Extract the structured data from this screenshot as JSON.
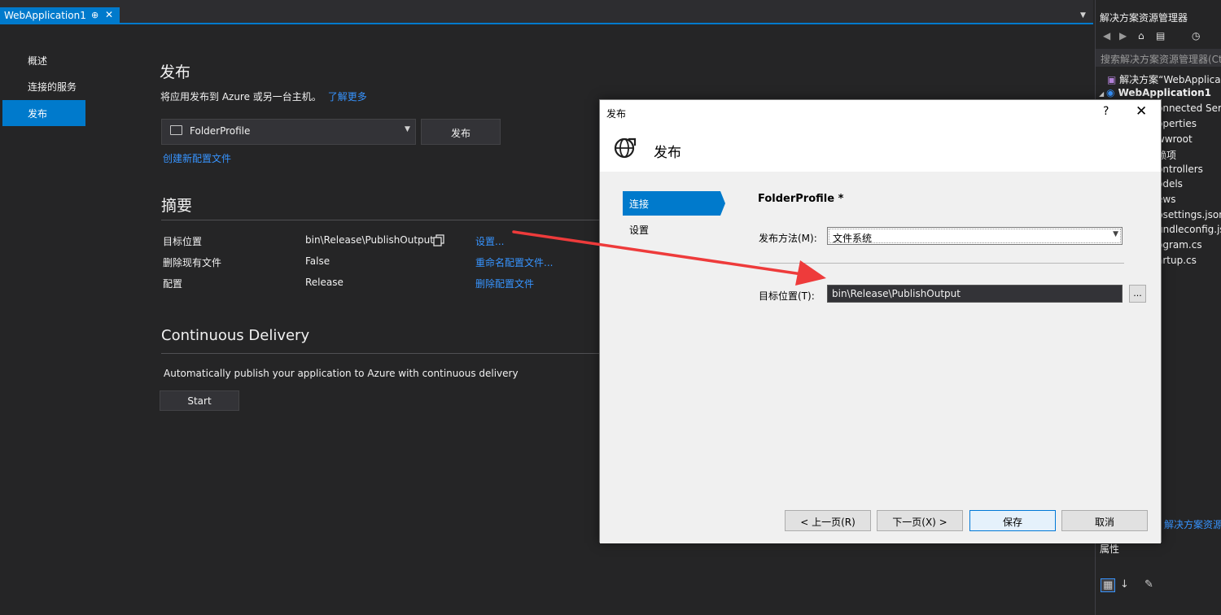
{
  "tab": {
    "title": "WebApplication1",
    "pin": "⊕",
    "close": "✕",
    "dropdown": "▼"
  },
  "leftnav": {
    "items": [
      {
        "label": "概述"
      },
      {
        "label": "连接的服务"
      },
      {
        "label": "发布"
      }
    ]
  },
  "main": {
    "title": "发布",
    "description": "将应用发布到 Azure 或另一台主机。",
    "learn_more": "了解更多",
    "profile": "FolderProfile",
    "publish_button": "发布",
    "create_profile_link": "创建新配置文件",
    "summary_title": "摘要",
    "summary_rows": [
      {
        "label": "目标位置",
        "value": "bin\\Release\\PublishOutput",
        "action": "设置..."
      },
      {
        "label": "删除现有文件",
        "value": "False",
        "action": "重命名配置文件..."
      },
      {
        "label": "配置",
        "value": "Release",
        "action": "删除配置文件"
      }
    ],
    "cd_title": "Continuous Delivery",
    "cd_description": "Automatically publish your application to Azure with continuous delivery",
    "start_button": "Start"
  },
  "solution_explorer": {
    "title": "解决方案资源管理器",
    "search_placeholder": "搜索解决方案资源管理器(Ctrl",
    "items": [
      {
        "text": "解决方案“WebApplica"
      },
      {
        "text": "WebApplication1"
      },
      {
        "text": "onnected Serv"
      },
      {
        "text": "operties"
      },
      {
        "text": "wwroot"
      },
      {
        "text": "赖项"
      },
      {
        "text": "ontrollers"
      },
      {
        "text": "odels"
      },
      {
        "text": "ews"
      },
      {
        "text": "psettings.json"
      },
      {
        "text": "undleconfig.js"
      },
      {
        "text": "ogram.cs"
      },
      {
        "text": "artup.cs"
      }
    ],
    "bottom_link": "解决方案资源",
    "properties_title": "属性"
  },
  "dialog": {
    "title": "发布",
    "help": "?",
    "close": "✕",
    "header_title": "发布",
    "steps": [
      {
        "label": "连接"
      },
      {
        "label": "设置"
      }
    ],
    "profile_heading": "FolderProfile *",
    "method_label": "发布方法(M):",
    "method_value": "文件系统",
    "target_label": "目标位置(T):",
    "target_value": "bin\\Release\\PublishOutput",
    "browse": "...",
    "buttons": {
      "prev": "< 上一页(R)",
      "next": "下一页(X) >",
      "save": "保存",
      "cancel": "取消"
    }
  },
  "colors": {
    "accent": "#007acc",
    "link": "#3794ff",
    "arrow": "#ee3b3b"
  }
}
